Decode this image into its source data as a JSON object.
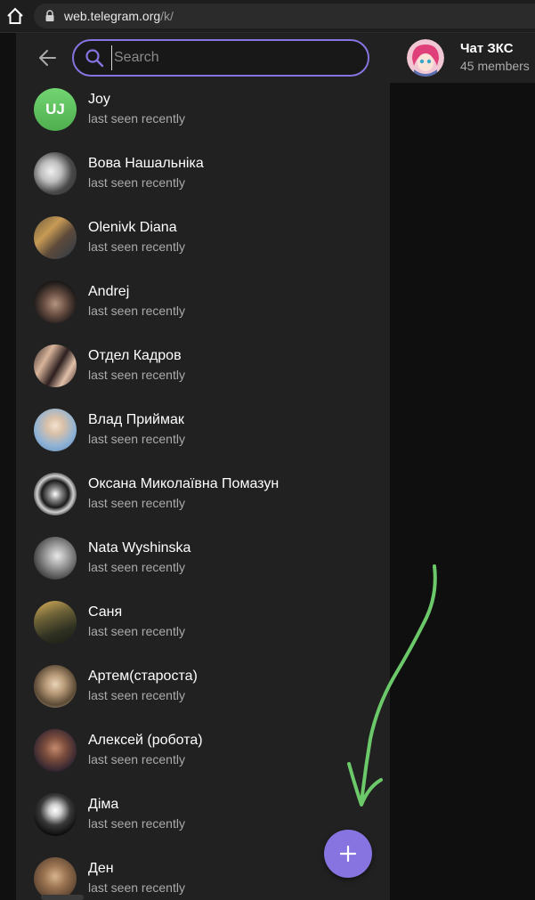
{
  "browser": {
    "url_host": "web.telegram.org",
    "url_path": "/k/"
  },
  "search": {
    "placeholder": "Search",
    "value": ""
  },
  "contacts": [
    {
      "name": "Joy",
      "status": "last seen recently",
      "initials": "UJ"
    },
    {
      "name": "Вова Нашальніка",
      "status": "last seen recently"
    },
    {
      "name": "Olenivk Diana",
      "status": "last seen recently"
    },
    {
      "name": "Andrej",
      "status": "last seen recently"
    },
    {
      "name": "Отдел Кадров",
      "status": "last seen recently"
    },
    {
      "name": "Влад Приймак",
      "status": "last seen recently"
    },
    {
      "name": "Оксана Миколаївна Помазун",
      "status": "last seen recently"
    },
    {
      "name": "Nata Wyshinska",
      "status": "last seen recently"
    },
    {
      "name": "Саня",
      "status": "last seen recently"
    },
    {
      "name": "Артем(староста)",
      "status": "last seen recently"
    },
    {
      "name": "Алексей (робота)",
      "status": "last seen recently"
    },
    {
      "name": "Діма",
      "status": "last seen recently"
    },
    {
      "name": "Ден",
      "status": "last seen recently"
    }
  ],
  "chat": {
    "title": "Чат ЗКС",
    "subtitle": "45 members"
  },
  "icons": {
    "home": "home-icon",
    "lock": "lock-icon",
    "back": "arrow-left-icon",
    "search": "search-icon",
    "fab": "plus-icon"
  },
  "colors": {
    "accent": "#8774e1",
    "sidebar_bg": "#212121",
    "annotation_arrow": "#6cc96a"
  }
}
